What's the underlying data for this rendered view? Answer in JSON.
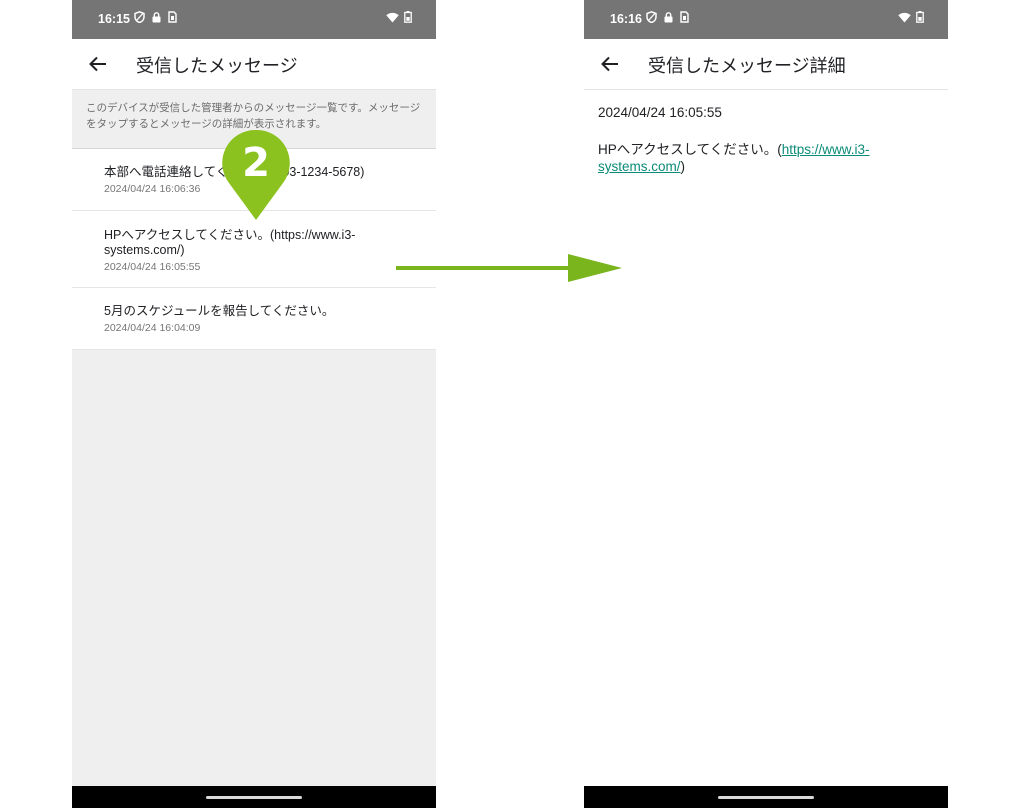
{
  "left": {
    "statusbar": {
      "time": "16:15"
    },
    "appbar": {
      "title": "受信したメッセージ"
    },
    "description": "このデバイスが受信した管理者からのメッセージ一覧です。メッセージをタップするとメッセージの詳細が表示されます。",
    "messages": [
      {
        "text": "本部へ電話連絡してください。(03-1234-5678)",
        "time": "2024/04/24 16:06:36"
      },
      {
        "text": "HPへアクセスしてください。(https://www.i3-systems.com/)",
        "time": "2024/04/24 16:05:55"
      },
      {
        "text": "5月のスケジュールを報告してください。",
        "time": "2024/04/24 16:04:09"
      }
    ]
  },
  "right": {
    "statusbar": {
      "time": "16:16"
    },
    "appbar": {
      "title": "受信したメッセージ詳細"
    },
    "detail": {
      "time": "2024/04/24 16:05:55",
      "text_prefix": "HPへアクセスしてください。(",
      "link": "https://www.i3-systems.com/",
      "text_suffix": ")"
    }
  },
  "annotation": {
    "step_number": "2",
    "marker_color": "#8cc21f",
    "arrow_color": "#7ab51d"
  },
  "colors": {
    "statusbar": "#757575",
    "link": "#0b8b78",
    "list_background": "#efefef"
  },
  "icons": {
    "back": "arrow-left-icon",
    "status_left": [
      "shield-icon",
      "lock-icon",
      "sim-card-icon"
    ],
    "status_right": [
      "wifi-icon",
      "battery-icon"
    ]
  }
}
